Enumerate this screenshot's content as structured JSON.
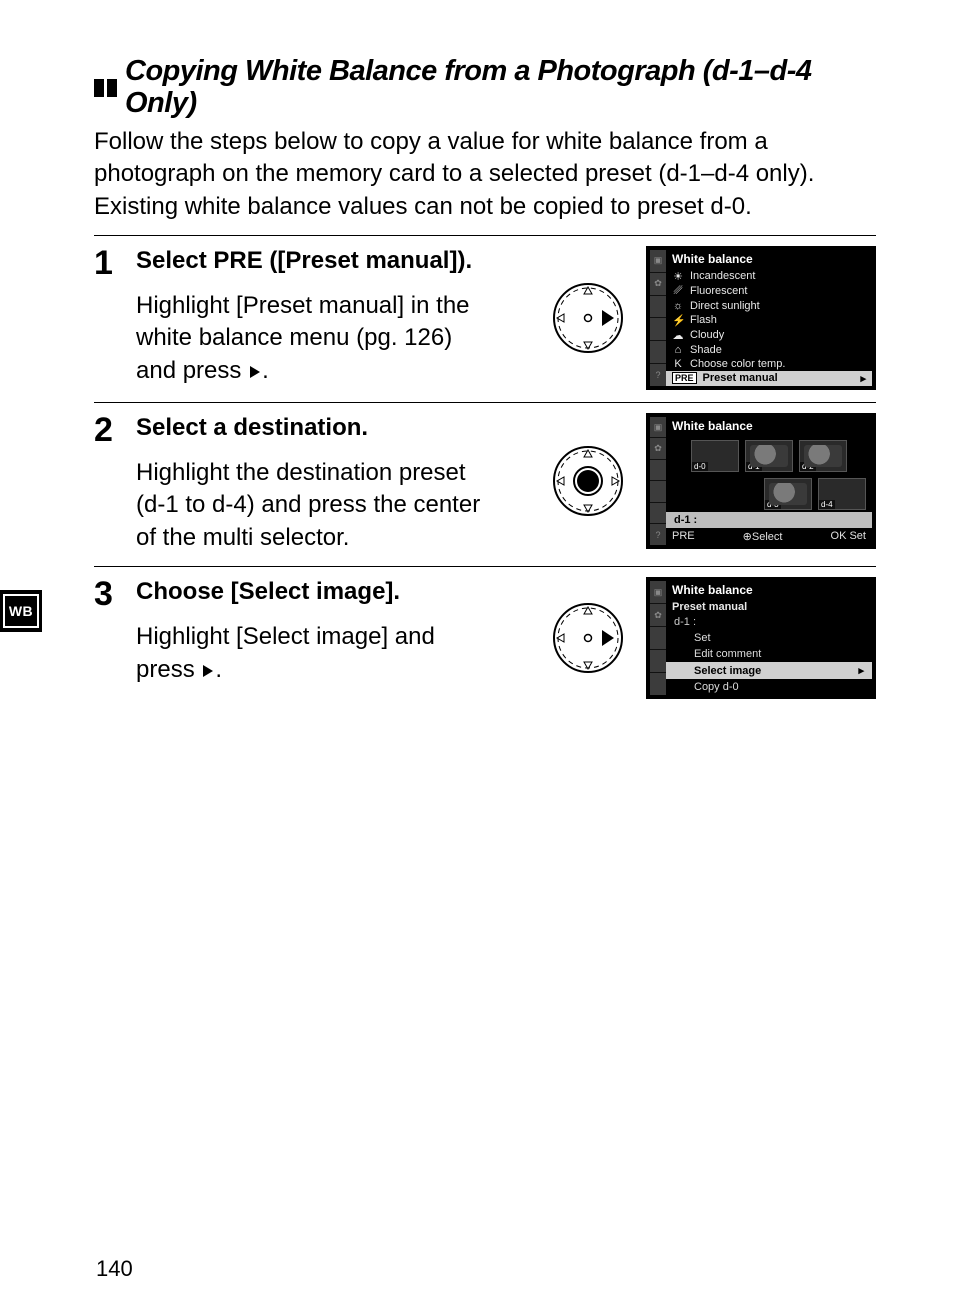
{
  "heading": "Copying White Balance from a Photograph (d-1–d-4 Only)",
  "intro": "Follow the steps below to copy a value for white balance from a photograph on the memory card to a selected preset (d-1–d-4 only).  Existing white balance values can not be copied to preset d-0.",
  "sidebar_tab": "WB",
  "page_number": "140",
  "steps": [
    {
      "num": "1",
      "title_pre": "Select ",
      "title_code": "PRE",
      "title_post": " ([Preset manual]).",
      "body_a": "Highlight [Preset manual] in the white balance menu (pg. 126) and press ",
      "body_b": "."
    },
    {
      "num": "2",
      "title": "Select a destination.",
      "body": "Highlight the destination preset (d-1 to d-4) and press the center of the multi selector."
    },
    {
      "num": "3",
      "title": "Choose [Select image].",
      "body_a": "Highlight [Select image] and press ",
      "body_b": "."
    }
  ],
  "lcd1": {
    "title": "White balance",
    "items": [
      {
        "icon": "☀",
        "label": "Incandescent"
      },
      {
        "icon": "␥",
        "label": "Fluorescent"
      },
      {
        "icon": "☼",
        "label": "Direct sunlight"
      },
      {
        "icon": "⚡",
        "label": "Flash"
      },
      {
        "icon": "☁",
        "label": "Cloudy"
      },
      {
        "icon": "⌂",
        "label": "Shade"
      },
      {
        "icon": "K",
        "label": "Choose color temp."
      }
    ],
    "pre_label": "PRE",
    "hl": "Preset manual"
  },
  "lcd2": {
    "title": "White balance",
    "thumbs_top": [
      "d-0",
      "d-1",
      "d-2"
    ],
    "thumbs_bot": [
      "d-3",
      "d-4"
    ],
    "sel": "d-1  :",
    "footer_left": "PRE",
    "footer_mid": "⊕Select",
    "footer_right": "OK Set"
  },
  "lcd3": {
    "title": "White balance",
    "subtitle": "Preset manual",
    "group": "d-1   :",
    "items": [
      "Set",
      "Edit comment",
      "Select image",
      "Copy d-0"
    ],
    "hl_index": 2
  }
}
